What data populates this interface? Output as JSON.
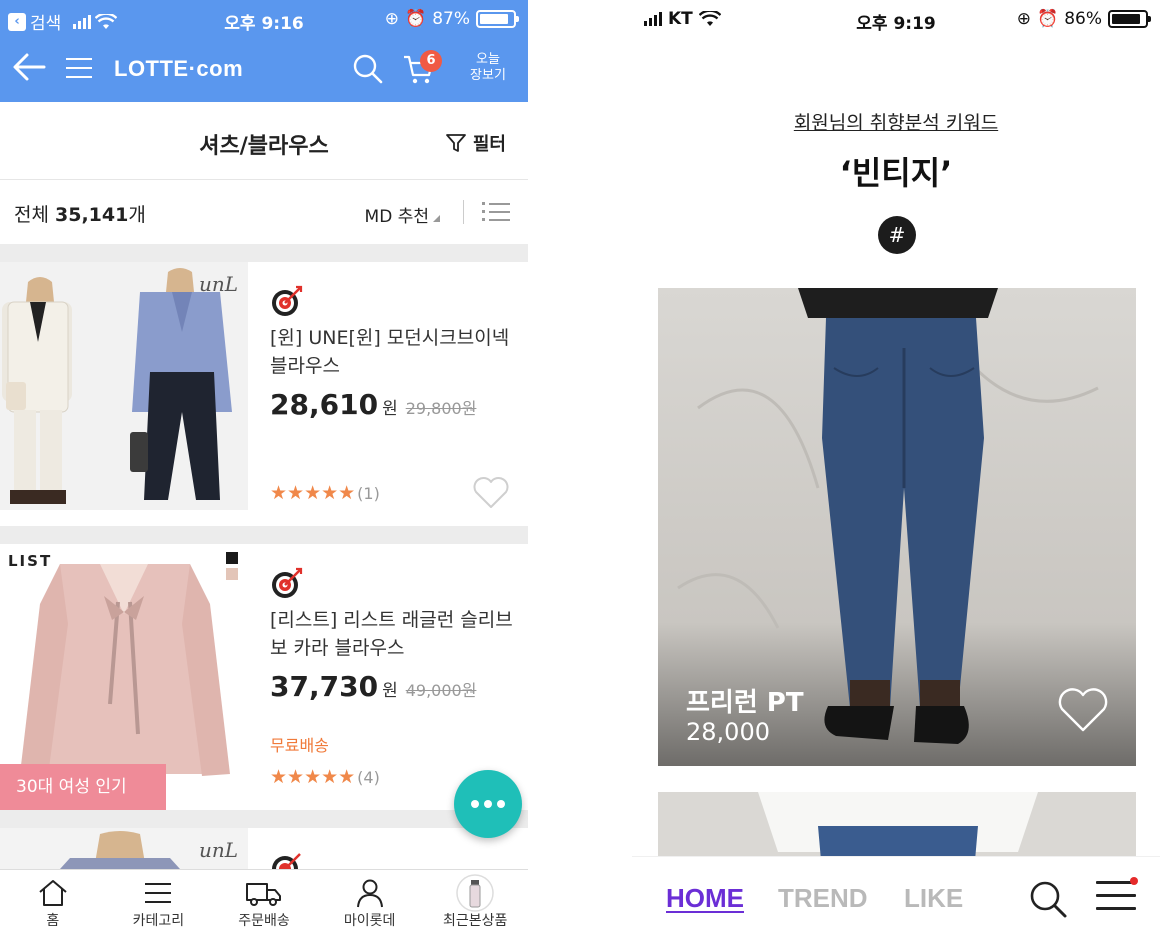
{
  "left": {
    "status": {
      "back_app": "검색",
      "time": "오후 9:16",
      "battery": "87%",
      "battery_level": 0.87
    },
    "header": {
      "logo": "LOTTE·com",
      "cart_count": "6",
      "today_line1": "오늘",
      "today_line2": "장보기"
    },
    "title": "셔츠/블라우스",
    "filter_label": "필터",
    "count": {
      "prefix": "전체 ",
      "value": "35,141",
      "suffix": "개"
    },
    "sort_label": "MD 추천",
    "products": [
      {
        "brand_mark": "unL",
        "name": "[윈] UNE[윈] 모던시크브이넥블라우스",
        "price": "28,610",
        "currency": "원",
        "original_price": "29,800원",
        "stars": "★★★★★",
        "review_count": "(1)"
      },
      {
        "tag": "LIST",
        "name": "[리스트] 리스트 래글런 슬리브 보 카라 블라우스",
        "price": "37,730",
        "currency": "원",
        "original_price": "49,000원",
        "shipping": "무료배송",
        "stars": "★★★★★",
        "review_count": "(4)",
        "badge": "30대 여성 인기",
        "swatch_colors": [
          "#1a1a1a",
          "#e3c5b8"
        ]
      },
      {
        "brand_mark": "unL"
      }
    ],
    "tabbar": [
      {
        "label": "홈",
        "icon": "home-icon"
      },
      {
        "label": "카테고리",
        "icon": "category-icon"
      },
      {
        "label": "주문배송",
        "icon": "truck-icon"
      },
      {
        "label": "마이롯데",
        "icon": "person-icon"
      },
      {
        "label": "최근본상품",
        "icon": "recent-product-icon"
      }
    ],
    "colors": {
      "header": "#5a97ee",
      "accent_orange": "#f07a3a",
      "badge_pink": "#ef8b98",
      "chat": "#1fbfb8"
    }
  },
  "right": {
    "status": {
      "carrier": "KT",
      "time": "오후 9:19",
      "battery": "86%",
      "battery_level": 0.86
    },
    "keyword_label": "회원님의 취향분석 키워드",
    "keyword": "‘빈티지’",
    "hash_symbol": "#",
    "product": {
      "name": "프리런 PT",
      "price": "28,000"
    },
    "tabs": {
      "home": "HOME",
      "trend": "TREND",
      "like": "LIKE"
    },
    "colors": {
      "active_tab": "#6b2ed6",
      "inactive_tab": "#b9b9b9",
      "notification_dot": "#e52a2a"
    }
  }
}
